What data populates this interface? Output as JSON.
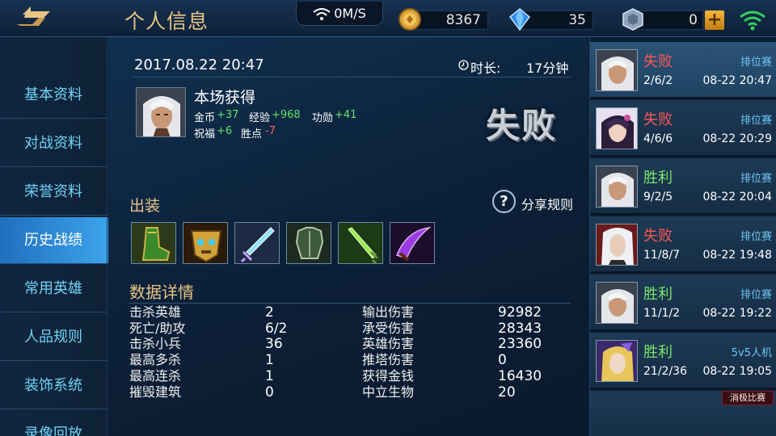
{
  "header": {
    "title": "个人信息",
    "net_speed": "0M/S",
    "gold": "8367",
    "diamonds": "35",
    "coupons": "0",
    "plus_label": "+"
  },
  "sidebar": {
    "items": [
      {
        "label": "基本资料"
      },
      {
        "label": "对战资料"
      },
      {
        "label": "荣誉资料"
      },
      {
        "label": "历史战绩"
      },
      {
        "label": "常用英雄"
      },
      {
        "label": "人品规则"
      },
      {
        "label": "装饰系统"
      },
      {
        "label": "录像回放"
      }
    ],
    "active_index": 3
  },
  "match": {
    "datetime": "2017.08.22 20:47",
    "duration_label": "时长:",
    "duration_value": "17分钟",
    "earned_title": "本场获得",
    "gold_label": "金币",
    "gold_value": "+37",
    "exp_label": "经验",
    "exp_value": "+968",
    "merit_label": "功勋",
    "merit_value": "+41",
    "bless_label": "祝福",
    "bless_value": "+6",
    "points_label": "胜点",
    "points_value": "-7",
    "result": "失败",
    "equip_title": "出装",
    "share_label": "分享规则",
    "help_label": "?",
    "detail_title": "数据详情",
    "details_left": [
      {
        "label": "击杀英雄",
        "value": "2"
      },
      {
        "label": "死亡/助攻",
        "value": "6/2"
      },
      {
        "label": "击杀小兵",
        "value": "36"
      },
      {
        "label": "最高多杀",
        "value": "1"
      },
      {
        "label": "最高连杀",
        "value": "1"
      },
      {
        "label": "摧毁建筑",
        "value": "0"
      }
    ],
    "details_right": [
      {
        "label": "输出伤害",
        "value": "92982"
      },
      {
        "label": "承受伤害",
        "value": "28343"
      },
      {
        "label": "英雄伤害",
        "value": "23360"
      },
      {
        "label": "推塔伤害",
        "value": "0"
      },
      {
        "label": "获得金钱",
        "value": "16430"
      },
      {
        "label": "中立生物",
        "value": "20"
      }
    ]
  },
  "history": [
    {
      "result": "失败",
      "type": "排位赛",
      "kda": "2/6/2",
      "date": "08-22 20:47",
      "outcome": "lose",
      "avatar": "white-hair-hero"
    },
    {
      "result": "失败",
      "type": "排位赛",
      "kda": "4/6/6",
      "date": "08-22 20:29",
      "outcome": "lose",
      "avatar": "dark-hair-heroine"
    },
    {
      "result": "胜利",
      "type": "排位赛",
      "kda": "9/2/5",
      "date": "08-22 20:04",
      "outcome": "win",
      "avatar": "white-hair-hero"
    },
    {
      "result": "失败",
      "type": "排位赛",
      "kda": "11/8/7",
      "date": "08-22 19:48",
      "outcome": "lose",
      "avatar": "silver-hair-hero"
    },
    {
      "result": "胜利",
      "type": "排位赛",
      "kda": "11/1/2",
      "date": "08-22 19:22",
      "outcome": "win",
      "avatar": "white-hair-hero"
    },
    {
      "result": "胜利",
      "type": "5v5人机",
      "kda": "21/2/36",
      "date": "08-22 19:05",
      "outcome": "win",
      "avatar": "purple-mage"
    }
  ],
  "cancel_label": "消极比赛",
  "colors": {
    "win": "#7ae66c",
    "lose": "#ff5656",
    "gold_text": "#e8c585",
    "accent": "#3ea6ee"
  }
}
